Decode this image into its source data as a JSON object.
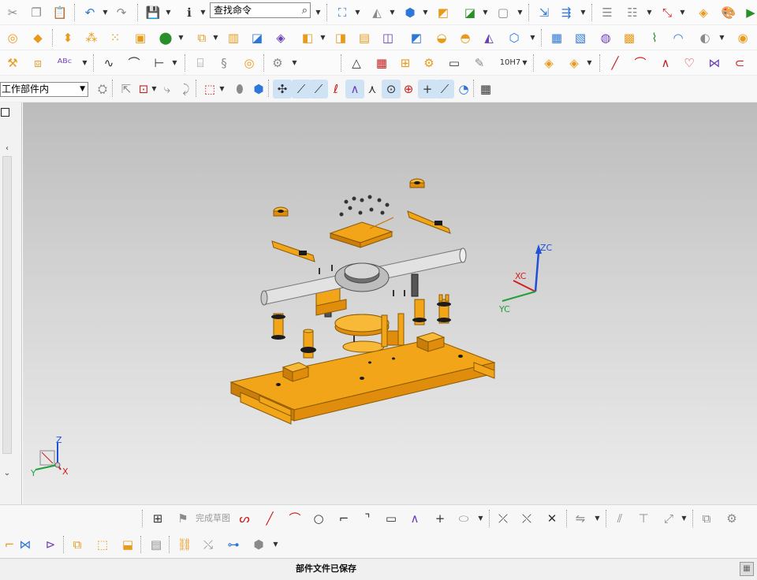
{
  "toolbar": {
    "find_command_placeholder": "查找命令",
    "row1_icons": [
      "cut-icon",
      "copy-icon",
      "paste-icon",
      "undo-icon",
      "redo-icon",
      "save-icon",
      "info-icon",
      "fit-view-icon",
      "snap-view-icon",
      "shaded-cube-icon",
      "edge-display-icon",
      "wireframe-view-icon",
      "background-icon",
      "tool-icon",
      "layer-icon",
      "layer-settings-icon",
      "list-icon",
      "orient-icon",
      "render-icon"
    ],
    "row2_icons": [
      "extrude-icon",
      "block-icon",
      "move-face-icon",
      "pattern-icon",
      "array-icon",
      "cube-icon",
      "add-shape-icon",
      "feature-icon",
      "shell-icon",
      "offset-icon",
      "sweep-icon",
      "edge-blend-icon",
      "chamfer-icon",
      "thicken-icon",
      "unite-icon",
      "subtract-icon",
      "intersect-icon",
      "trim-icon",
      "surface-icon",
      "mesh-icon",
      "sew-icon",
      "swoop-icon",
      "ruled-icon",
      "face-icon",
      "bridge-icon",
      "grid-surface-icon"
    ],
    "row3_icons": [
      "tools-icon",
      "part-icon",
      "abc-text-icon",
      "curve-icon",
      "cylinder-icon",
      "spring-icon",
      "bearing-icon",
      "gear-icon",
      "triangle-icon",
      "table-icon",
      "chart-icon",
      "assembly-icon",
      "note-icon",
      "pen-icon",
      "measure-icon",
      "tolerance-icon",
      "assembly-part-icon",
      "layout-icon",
      "line-icon",
      "arc-icon",
      "spline-icon",
      "fillet-curve-icon",
      "offset-curve-icon"
    ],
    "row3_measure_label": "10H7",
    "row4_icons": [
      "filter-icon",
      "select-icon",
      "snap-icon",
      "select-face-icon",
      "select-body-icon",
      "endpoint-icon",
      "midpoint-icon",
      "control-icon",
      "intersection-icon",
      "arc-center-icon",
      "tangent-icon",
      "center-icon",
      "quadrant-icon",
      "point-icon",
      "on-curve-icon",
      "on-face-icon",
      "grid-icon"
    ]
  },
  "selection_scope": {
    "value": "工作部件内"
  },
  "sketch_toolbar": {
    "finish_sketch_label": "完成草图",
    "icons": [
      "sketch-icon",
      "finish-sketch-icon",
      "profile-icon",
      "line-icon",
      "arc-icon",
      "circle-icon",
      "fillet-icon",
      "chamfer-icon",
      "rectangle-icon",
      "polygon-icon",
      "point-icon",
      "offset-icon",
      "trim-icon",
      "extend-icon",
      "corner-icon",
      "mirror-icon",
      "dimension-icon",
      "constraint-icon",
      "relations-icon",
      "show-constraints-icon"
    ]
  },
  "assembly_toolbar": {
    "icons": [
      "component-icon",
      "mirror-assembly-icon",
      "mate-icon",
      "constraint-icon",
      "array-component-icon",
      "move-component-icon",
      "clearance-icon",
      "link-icon",
      "wave-icon",
      "explode-icon",
      "navigator-icon"
    ]
  },
  "status_bar": {
    "message": "部件文件已保存"
  },
  "viewport": {
    "model": "exploded vise assembly",
    "colors": {
      "background_top": "#bcbcbc",
      "background_bottom": "#ececec",
      "part_body": "#f3a51a",
      "part_shadow": "#c97d0a",
      "part_dark": "#1c1c1c",
      "rod": "#d9d9d9"
    },
    "axes": {
      "x_label": "XC",
      "y_label": "YC",
      "z_label": "ZC",
      "x_color": "#d22020",
      "y_color": "#20a03a",
      "z_color": "#2050d8"
    },
    "triad": {
      "x_label": "X",
      "y_label": "Y",
      "z_label": "Z"
    }
  }
}
